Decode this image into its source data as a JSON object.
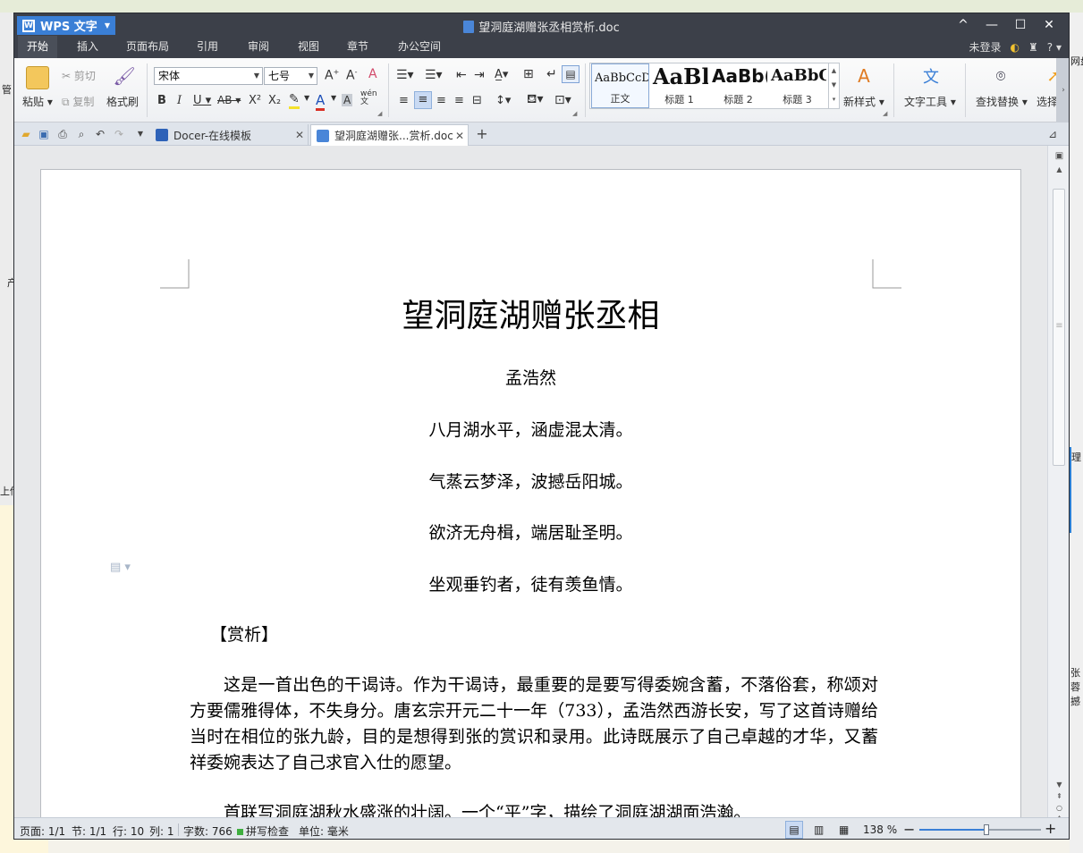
{
  "window": {
    "app_name": "WPS 文字",
    "title": "望洞庭湖赠张丞相赏析.doc",
    "controls": [
      "^",
      "—",
      "☐",
      "✕"
    ]
  },
  "menu": {
    "items": [
      "开始",
      "插入",
      "页面布局",
      "引用",
      "审阅",
      "视图",
      "章节",
      "办公空间"
    ],
    "active": "开始",
    "login": "未登录",
    "help": "?"
  },
  "ribbon": {
    "paste": "粘贴",
    "cut": "剪切",
    "copy": "复制",
    "format_painter": "格式刷",
    "font_name": "宋体",
    "font_size": "七号",
    "bold": "B",
    "italic": "I",
    "underline": "U",
    "strike": "AB",
    "superscript": "X²",
    "subscript": "X₂",
    "styles": [
      {
        "sample": "AaBbCcDd",
        "label": "正文"
      },
      {
        "sample": "AaBl",
        "label": "标题 1"
      },
      {
        "sample": "AaBb(",
        "label": "标题 2"
      },
      {
        "sample": "AaBbC",
        "label": "标题 3"
      }
    ],
    "new_style": "新样式",
    "text_tools": "文字工具",
    "find_replace": "查找替换",
    "select": "选择"
  },
  "tabs": [
    {
      "label": "Docer-在线模板",
      "active": false
    },
    {
      "label": "望洞庭湖赠张...赏析.doc",
      "active": true
    }
  ],
  "document": {
    "title": "望洞庭湖赠张丞相",
    "author": "孟浩然",
    "lines": [
      "八月湖水平，涵虚混太清。",
      "气蒸云梦泽，波撼岳阳城。",
      "欲济无舟楫，端居耻圣明。",
      "坐观垂钓者，徒有羡鱼情。"
    ],
    "section_heading": "【赏析】",
    "paragraphs": [
      "这是一首出色的干谒诗。作为干谒诗，最重要的是要写得委婉含蓄，不落俗套，称颂对方要儒雅得体，不失身分。唐玄宗开元二十一年（733），孟浩然西游长安，写了这首诗赠给当时在相位的张九龄，目的是想得到张的赏识和录用。此诗既展示了自己卓越的才华，又蓄祥委婉表达了自己求官入仕的愿望。",
      "首联写洞庭湖秋水盛涨的壮阔。一个“平”字，描绘了洞庭湖湖面浩瀚。"
    ]
  },
  "status": {
    "page": "页面: 1/1",
    "section": "节: 1/1",
    "line": "行: 10",
    "col": "列: 1",
    "word_count": "字数: 766",
    "spell_check": "拼写检查",
    "unit": "单位: 毫米",
    "zoom": "138 %",
    "zoom_level": 0.55
  },
  "colors": {
    "accent": "#3a7fd6",
    "titlebar": "#3c4049",
    "spell_indicator": "#3fae3f"
  },
  "background_fragments": [
    "管",
    "产",
    "上传",
    "网盘",
    "理",
    "张",
    "蓉",
    "撼"
  ]
}
